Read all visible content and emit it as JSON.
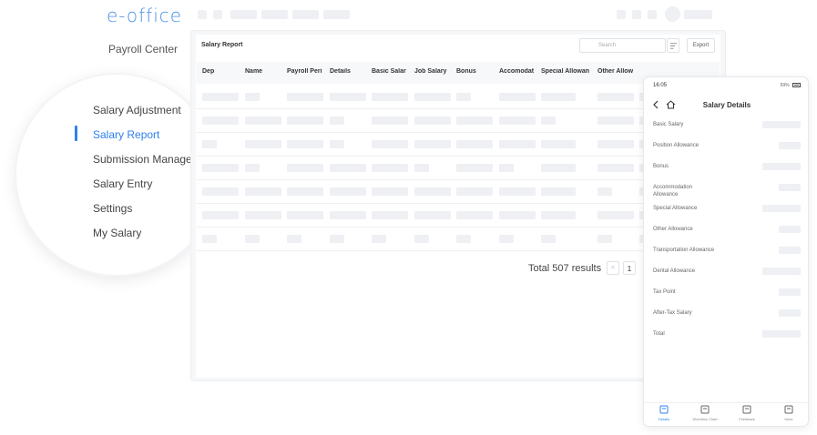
{
  "brand": {
    "logo_text": "e-office"
  },
  "sidebar": {
    "heading": "Payroll Center",
    "items": [
      {
        "label": "Salary Adjustment",
        "active": false
      },
      {
        "label": "Salary Report",
        "active": true
      },
      {
        "label": "Submission Management",
        "active": false
      },
      {
        "label": "Salary Entry",
        "active": false
      },
      {
        "label": "Settings",
        "active": false
      },
      {
        "label": "My Salary",
        "active": false
      }
    ]
  },
  "report": {
    "title": "Salary Report",
    "search_placeholder": "Search",
    "filter_icon": "filter-icon",
    "export_label": "Export",
    "columns": [
      "Dep",
      "Name",
      "Payroll Peri",
      "Details",
      "Basic Salar",
      "Job Salary",
      "Bonus",
      "Accomodat",
      "Special Allowan",
      "Other Allow"
    ],
    "total_text": "Total 507 results",
    "page_prev": "<",
    "current_page": "1"
  },
  "mobile": {
    "status_time": "16:05",
    "status_battery": "59%",
    "title": "Salary Details",
    "fields": [
      "Basic Salary",
      "Position Allowance",
      "Bonus",
      "Accommodation Allowance",
      "Special Allowance",
      "Other Allowance",
      "Transportation Allowance",
      "Dental Allowance",
      "Tax Point",
      "After-Tax Salary",
      "Total"
    ],
    "tabs": [
      {
        "label": "Details",
        "icon": "details-icon",
        "active": true
      },
      {
        "label": "Workflow Chart",
        "icon": "workflow-icon",
        "active": false
      },
      {
        "label": "Feedback",
        "icon": "feedback-icon",
        "active": false
      },
      {
        "label": "More",
        "icon": "more-icon",
        "active": false
      }
    ]
  },
  "colors": {
    "accent": "#2f80ed",
    "placeholder": "#eef0f3"
  }
}
